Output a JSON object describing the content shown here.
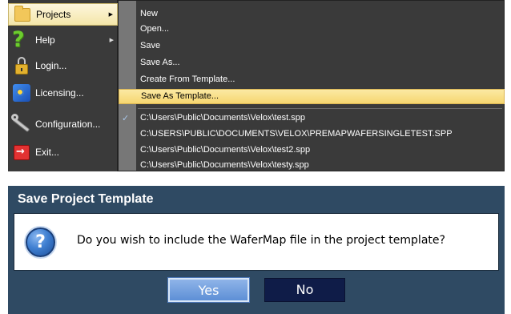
{
  "app_menu": {
    "items": [
      {
        "label": "Projects",
        "icon": "folder-icon",
        "has_submenu": true,
        "highlighted": true
      },
      {
        "label": "Help",
        "icon": "help-icon",
        "has_submenu": true
      },
      {
        "label": "Login...",
        "icon": "lock-icon"
      },
      {
        "label": "Licensing...",
        "icon": "licensing-icon"
      },
      {
        "label": "Configuration...",
        "icon": "wrench-icon"
      },
      {
        "label": "Exit...",
        "icon": "exit-icon"
      }
    ]
  },
  "submenu": {
    "items": [
      {
        "label": "New"
      },
      {
        "label": "Open..."
      },
      {
        "label": "Save"
      },
      {
        "label": "Save As..."
      },
      {
        "label": "Create From Template..."
      },
      {
        "label": "Save As Template...",
        "highlighted": true
      }
    ],
    "recent_files": [
      {
        "label": "C:\\Users\\Public\\Documents\\Velox\\test.spp",
        "checked": true
      },
      {
        "label": "C:\\USERS\\PUBLIC\\DOCUMENTS\\VELOX\\PREMAPWAFERSINGLETEST.SPP"
      },
      {
        "label": "C:\\Users\\Public\\Documents\\Velox\\test2.spp"
      },
      {
        "label": "C:\\Users\\Public\\Documents\\Velox\\testy.spp"
      }
    ],
    "check_glyph": "✓"
  },
  "dialog": {
    "title": "Save Project Template",
    "message": "Do you wish to include the WaferMap file in the project template?",
    "icon": "question-icon",
    "icon_glyph": "?",
    "yes_label": "Yes",
    "no_label": "No"
  },
  "colors": {
    "menu_bg": "#3a3a3a",
    "highlight": "#f6d670",
    "dialog_bg": "#2f4a63",
    "yes_button": "#5d8fd6",
    "no_button": "#0f1c48"
  },
  "glyphs": {
    "submenu_arrow": "▶",
    "help": "?",
    "exit_arrow": "→"
  }
}
